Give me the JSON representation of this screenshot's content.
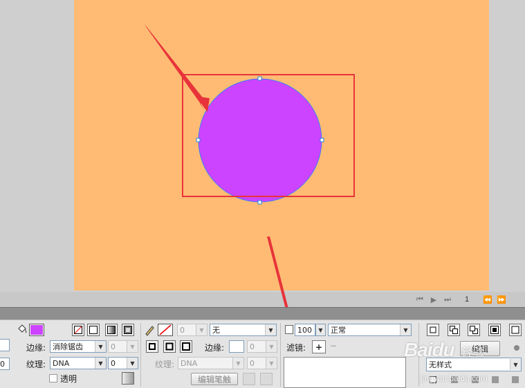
{
  "colors": {
    "stage_bg": "#ffbb73",
    "circle_fill": "#cc44ff",
    "circle_stroke": "#3b82f6",
    "annotation_red": "#e8333a",
    "fill_swatch": "#cc44ff"
  },
  "page_nav": {
    "current_page": "1"
  },
  "fill_section": {
    "edge_label": "边缘:",
    "edge_value": "消除锯齿",
    "edge_amount": "0",
    "texture_label": "纹理:",
    "texture_value": "DNA",
    "texture_amount": "0",
    "transparent_label": "透明",
    "left_cut_top": "0",
    "left_cut_bottom": "0"
  },
  "stroke_section": {
    "stroke_size": "0",
    "stroke_style": "无",
    "edge_label": "边缘:",
    "edge_amount": "0",
    "texture_label": "纹理:",
    "texture_value": "DNA",
    "texture_amount": "0",
    "edit_brush_label": "编辑笔触"
  },
  "effects_section": {
    "opacity": "100",
    "blend_mode": "正常",
    "filter_label": "滤镜:",
    "add_filter_glyph": "+",
    "remove_filter_glyph": "−"
  },
  "styles_section": {
    "style_value": "无样式",
    "partial_label": "编辑"
  },
  "watermark": {
    "brand": "Baidu",
    "sub_brand": "经验",
    "url": "jingyan.baidu.com"
  }
}
